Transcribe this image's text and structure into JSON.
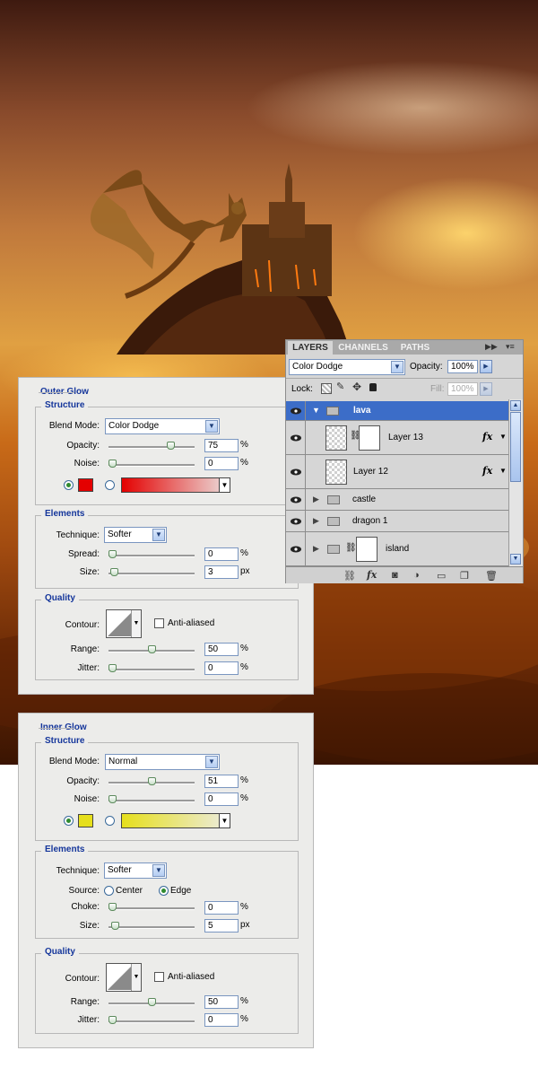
{
  "layers_panel": {
    "tabs": [
      "LAYERS",
      "CHANNELS",
      "PATHS"
    ],
    "blend_mode": "Color Dodge",
    "opacity_label": "Opacity:",
    "opacity_value": "100%",
    "lock_label": "Lock:",
    "fill_label": "Fill:",
    "fill_value": "100%",
    "fx_label": "fx",
    "layers": [
      {
        "name": "lava"
      },
      {
        "name": "Layer 13"
      },
      {
        "name": "Layer 12"
      },
      {
        "name": "castle"
      },
      {
        "name": "dragon 1"
      },
      {
        "name": "island"
      }
    ]
  },
  "outer_glow": {
    "title": "Outer Glow",
    "structure_legend": "Structure",
    "blend_mode_label": "Blend Mode:",
    "blend_mode": "Color Dodge",
    "opacity_label": "Opacity:",
    "opacity": "75",
    "opacity_level": 0.75,
    "noise_label": "Noise:",
    "noise": "0",
    "noise_level": 0,
    "pct": "%",
    "px": "px",
    "glow_color": "#e40000",
    "elements_legend": "Elements",
    "technique_label": "Technique:",
    "technique": "Softer",
    "spread_label": "Spread:",
    "spread": "0",
    "spread_level": 0,
    "size_label": "Size:",
    "size": "3",
    "size_level": 0.02,
    "quality_legend": "Quality",
    "contour_label": "Contour:",
    "anti_aliased_label": "Anti-aliased",
    "range_label": "Range:",
    "range": "50",
    "range_level": 0.5,
    "jitter_label": "Jitter:",
    "jitter": "0",
    "jitter_level": 0
  },
  "inner_glow": {
    "title": "Inner Glow",
    "structure_legend": "Structure",
    "blend_mode_label": "Blend Mode:",
    "blend_mode": "Normal",
    "opacity_label": "Opacity:",
    "opacity": "51",
    "opacity_level": 0.51,
    "noise_label": "Noise:",
    "noise": "0",
    "noise_level": 0,
    "pct": "%",
    "px": "px",
    "glow_color": "#e6df1c",
    "elements_legend": "Elements",
    "technique_label": "Technique:",
    "technique": "Softer",
    "source_label": "Source:",
    "source_center_label": "Center",
    "source_edge_label": "Edge",
    "choke_label": "Choke:",
    "choke": "0",
    "choke_level": 0,
    "size_label": "Size:",
    "size": "5",
    "size_level": 0.03,
    "quality_legend": "Quality",
    "contour_label": "Contour:",
    "anti_aliased_label": "Anti-aliased",
    "range_label": "Range:",
    "range": "50",
    "range_level": 0.5,
    "jitter_label": "Jitter:",
    "jitter": "0",
    "jitter_level": 0
  }
}
